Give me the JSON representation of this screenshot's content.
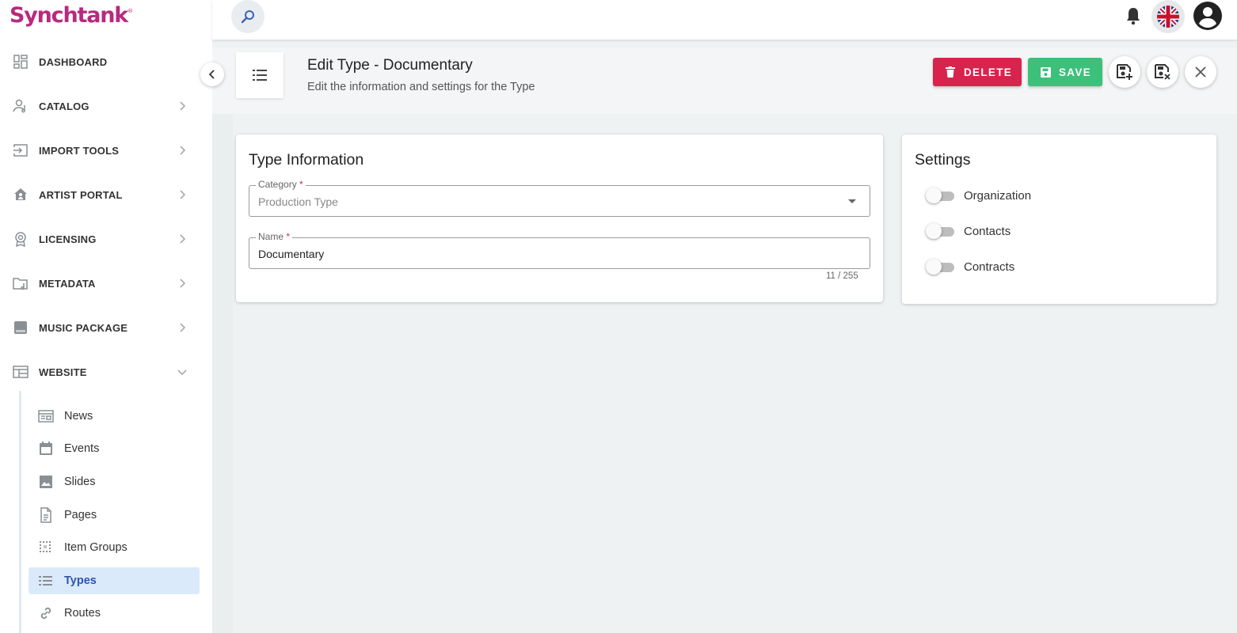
{
  "brand": {
    "logo_text": "Synchtank",
    "logo_mark": "®",
    "color": "#b8297f"
  },
  "sidebar": {
    "items": [
      {
        "label": "DASHBOARD",
        "icon": "dashboard-icon"
      },
      {
        "label": "CATALOG",
        "icon": "catalog-icon"
      },
      {
        "label": "IMPORT TOOLS",
        "icon": "import-icon"
      },
      {
        "label": "ARTIST PORTAL",
        "icon": "artist-portal-icon"
      },
      {
        "label": "LICENSING",
        "icon": "licensing-icon"
      },
      {
        "label": "METADATA",
        "icon": "metadata-icon"
      },
      {
        "label": "MUSIC PACKAGE",
        "icon": "music-package-icon"
      },
      {
        "label": "WEBSITE",
        "icon": "website-icon",
        "expanded": true
      }
    ],
    "subitems": [
      {
        "label": "News",
        "icon": "news-icon"
      },
      {
        "label": "Events",
        "icon": "calendar-icon"
      },
      {
        "label": "Slides",
        "icon": "image-icon"
      },
      {
        "label": "Pages",
        "icon": "page-icon"
      },
      {
        "label": "Item Groups",
        "icon": "grid-icon"
      },
      {
        "label": "Types",
        "icon": "list-icon",
        "active": true
      },
      {
        "label": "Routes",
        "icon": "link-icon"
      }
    ]
  },
  "header": {
    "title": "Edit Type - Documentary",
    "subtitle": "Edit the information and settings for the Type",
    "delete_label": "DELETE",
    "save_label": "SAVE"
  },
  "type_info": {
    "title": "Type Information",
    "category": {
      "label": "Category",
      "required": "*",
      "value": "Production Type"
    },
    "name": {
      "label": "Name",
      "required": "*",
      "value": "Documentary",
      "counter": "11 / 255"
    }
  },
  "settings": {
    "title": "Settings",
    "toggles": [
      {
        "label": "Organization",
        "on": false
      },
      {
        "label": "Contacts",
        "on": false
      },
      {
        "label": "Contracts",
        "on": false
      }
    ]
  },
  "colors": {
    "delete": "#d8244d",
    "save": "#3cc07a",
    "active_nav": "#2c56a8"
  }
}
